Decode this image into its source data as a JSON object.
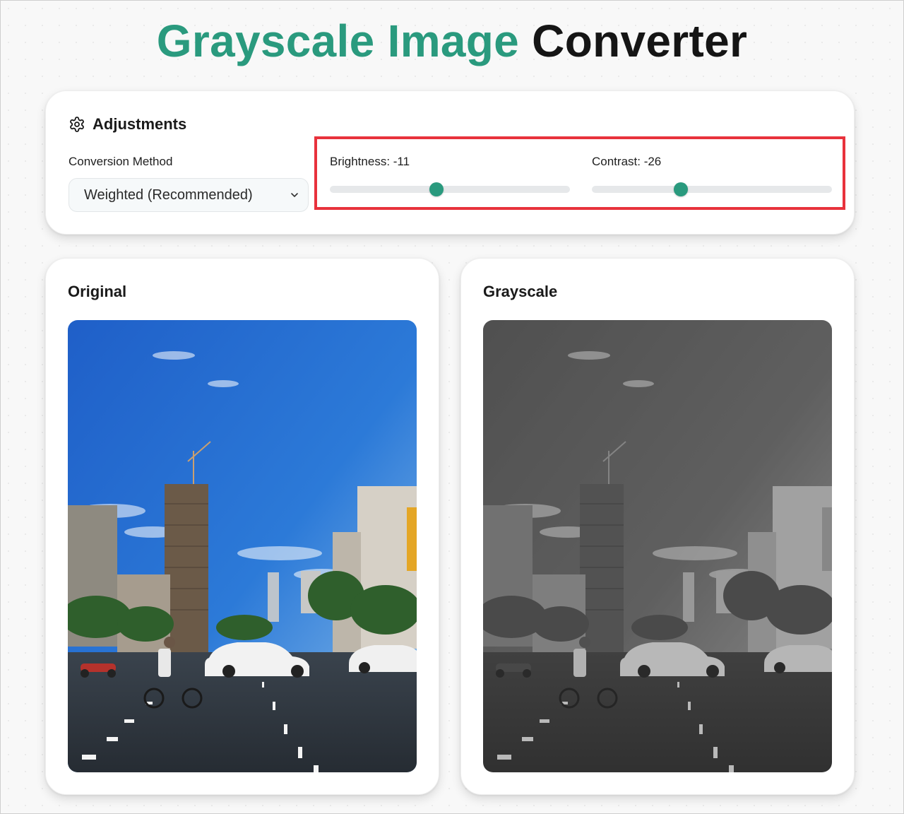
{
  "page": {
    "title_part1": "Grayscale Image",
    "title_part2": "Converter",
    "accent_color": "#2a9a7e",
    "highlight_color": "#e8323c"
  },
  "adjustments": {
    "title": "Adjustments",
    "icon": "gear-icon",
    "method_label": "Conversion Method",
    "method_value": "Weighted (Recommended)",
    "brightness_label": "Brightness: -11",
    "brightness_value": -11,
    "contrast_label": "Contrast: -26",
    "contrast_value": -26,
    "slider_min": -100,
    "slider_max": 100
  },
  "panels": {
    "original_title": "Original",
    "grayscale_title": "Grayscale"
  }
}
